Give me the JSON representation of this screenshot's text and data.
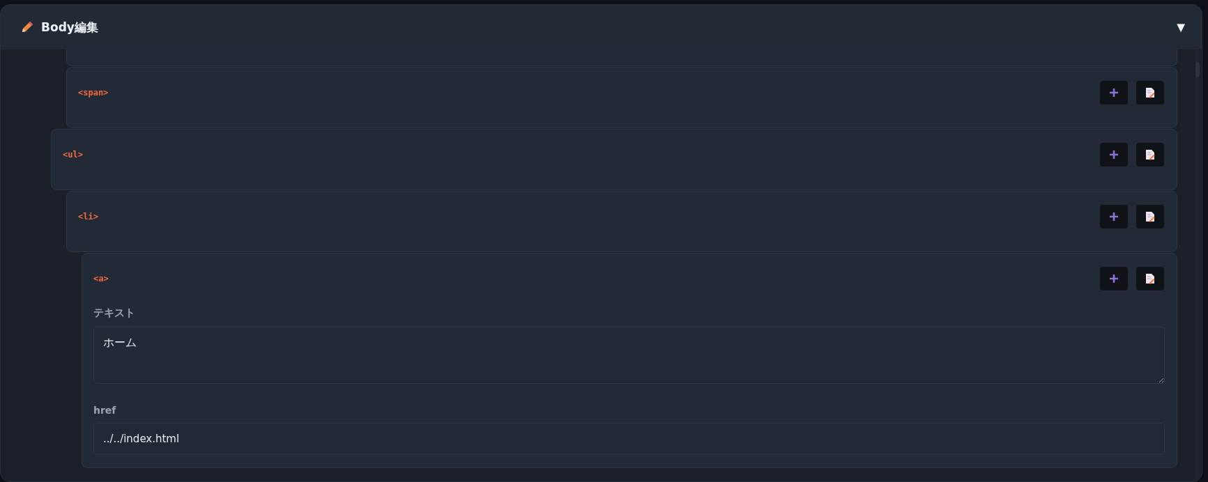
{
  "panel": {
    "title": "Body編集",
    "toggle": "▼"
  },
  "tree": [
    {
      "kind": "group",
      "children": [
        {
          "kind": "clipped"
        },
        {
          "kind": "element",
          "tag": "<span>"
        }
      ]
    },
    {
      "kind": "element",
      "tag": "<ul>",
      "children": [
        {
          "kind": "element",
          "tag": "<li>",
          "children": [
            {
              "kind": "element",
              "tag": "<a>",
              "fields": [
                {
                  "kind": "textarea",
                  "label": "テキスト",
                  "value": "ホーム"
                },
                {
                  "kind": "input",
                  "label": "href",
                  "value": "../../index.html"
                }
              ]
            }
          ]
        }
      ]
    }
  ]
}
